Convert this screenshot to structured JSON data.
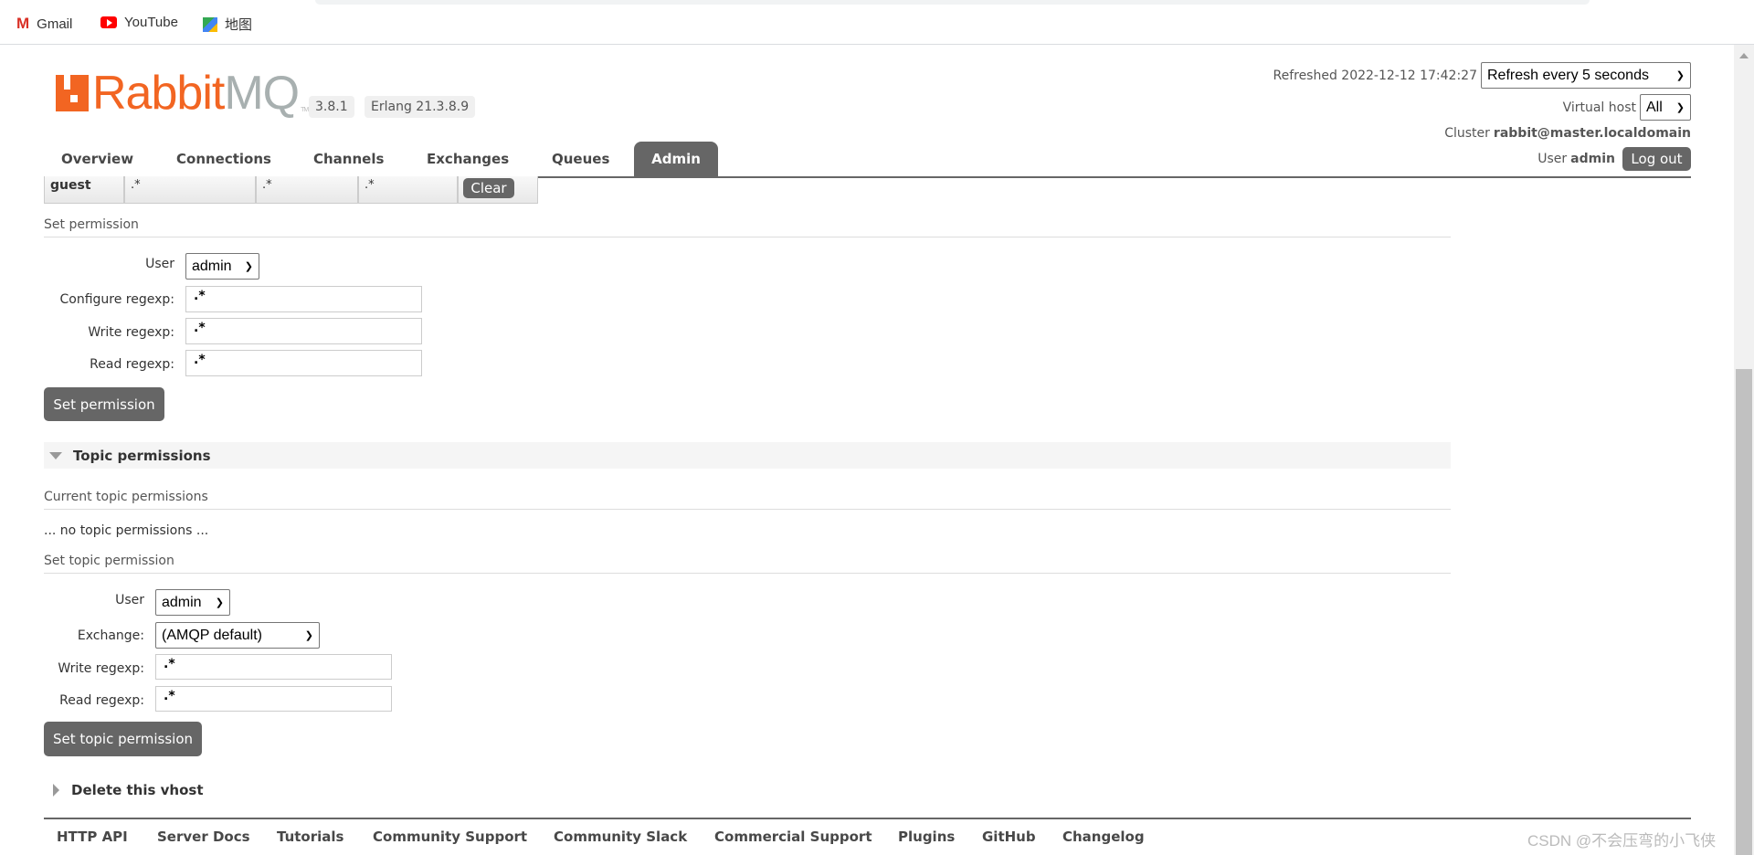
{
  "bookmarks": [
    {
      "label": "Gmail",
      "icon": "gmail-icon"
    },
    {
      "label": "YouTube",
      "icon": "youtube-icon"
    },
    {
      "label": "地图",
      "icon": "maps-icon"
    }
  ],
  "logo": {
    "rabbit": "Rabbit",
    "mq": "MQ",
    "tm": "TM",
    "brand_color": "#f26522"
  },
  "version": "3.8.1",
  "erlang": "Erlang 21.3.8.9",
  "nav": {
    "tabs": [
      "Overview",
      "Connections",
      "Channels",
      "Exchanges",
      "Queues",
      "Admin"
    ],
    "active": "Admin"
  },
  "header": {
    "refreshed_label": "Refreshed 2022-12-12 17:42:27",
    "refresh_select": "Refresh every 5 seconds",
    "vhost_label": "Virtual host",
    "vhost_select": "All",
    "cluster_label": "Cluster",
    "cluster_value": "rabbit@master.localdomain",
    "user_label": "User",
    "user_value": "admin",
    "logout": "Log out"
  },
  "permissions_row": {
    "user": "guest",
    "configure": ".*",
    "write": ".*",
    "read": ".*",
    "clear": "Clear"
  },
  "set_permission": {
    "title": "Set permission",
    "user_label": "User",
    "user_value": "admin",
    "configure_label": "Configure regexp:",
    "configure_value": ".*",
    "write_label": "Write regexp:",
    "write_value": ".*",
    "read_label": "Read regexp:",
    "read_value": ".*",
    "button": "Set permission"
  },
  "topic": {
    "section": "Topic permissions",
    "current_title": "Current topic permissions",
    "empty": "... no topic permissions ...",
    "set_title": "Set topic permission",
    "user_label": "User",
    "user_value": "admin",
    "exchange_label": "Exchange:",
    "exchange_value": "(AMQP default)",
    "write_label": "Write regexp:",
    "write_value": ".*",
    "read_label": "Read regexp:",
    "read_value": ".*",
    "button": "Set topic permission"
  },
  "delete_section": "Delete this vhost",
  "footer": [
    "HTTP API",
    "Server Docs",
    "Tutorials",
    "Community Support",
    "Community Slack",
    "Commercial Support",
    "Plugins",
    "GitHub",
    "Changelog"
  ],
  "watermark": "CSDN @不会压弯的小飞侠"
}
